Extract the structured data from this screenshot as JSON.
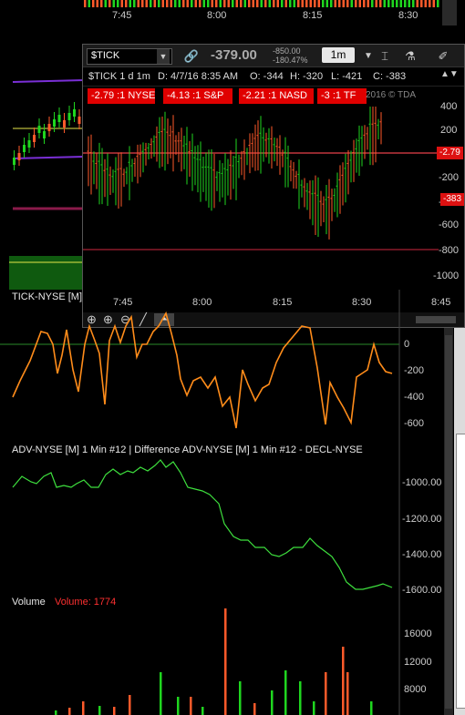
{
  "top_strip": {
    "times": [
      "7:45",
      "8:00",
      "8:15",
      "8:30"
    ]
  },
  "popup": {
    "symbol": "$TICK",
    "price": "-379.00",
    "change_top": "-850.00",
    "change_bottom": "-180.47%",
    "timeframe": "1m",
    "info": {
      "symbol": "$TICK 1 d 1m",
      "date": "D: 4/7/16 8:35 AM",
      "open": "O: -344",
      "high": "H: -320",
      "low": "L: -421",
      "close": "C: -383"
    },
    "badges": [
      "-2.79 :1 NYSE",
      "-4.13 :1 S&P",
      "-2.21 :1 NASD",
      "-3 :1 TF"
    ],
    "copyright": "2016 © TDA",
    "y_ticks": [
      "400",
      "200",
      "0",
      "-200",
      "-400",
      "-600",
      "-800",
      "-1000"
    ],
    "price_tags": [
      "-2.79",
      "-383"
    ],
    "x_ticks": [
      "7:45",
      "8:00",
      "8:15",
      "8:30",
      "8:45"
    ]
  },
  "tick_panel": {
    "label": "TICK-NYSE [M]",
    "y_ticks": [
      "0",
      "-200",
      "-400",
      "-600"
    ]
  },
  "adv_panel": {
    "label": "ADV-NYSE [M]  1 Min  #12 | Difference ADV-NYSE [M]  1 Min  #12 - DECL-NYSE",
    "y_ticks": [
      "-1000.00",
      "-1200.00",
      "-1400.00",
      "-1600.00"
    ]
  },
  "volume_panel": {
    "label": "Volume",
    "value_label": "Volume: 1774",
    "y_ticks": [
      "16000",
      "12000",
      "8000"
    ]
  },
  "colors": {
    "up": "#1fd61f",
    "down": "#ff5a2a",
    "tick_line": "#ff8c1a",
    "adv_line": "#3ee03e",
    "zero_line": "#2a8a2a",
    "alert_line": "#e8404a",
    "dark_red_line": "#8b1a2a"
  }
}
